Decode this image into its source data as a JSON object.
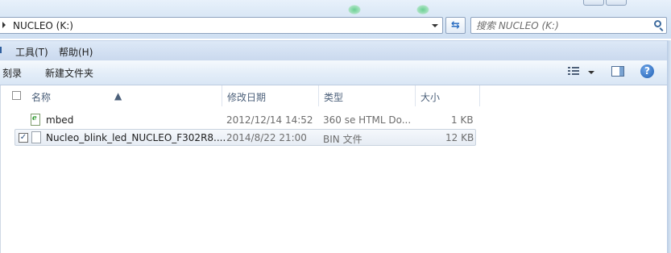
{
  "address_bar": {
    "path": "NUCLEO (K:)"
  },
  "search": {
    "placeholder": "搜索 NUCLEO (K:)"
  },
  "menu": {
    "items": [
      {
        "label": "工具(T)"
      },
      {
        "label": "帮助(H)"
      }
    ]
  },
  "toolbar": {
    "burn_label": "刻录",
    "new_folder_label": "新建文件夹",
    "help_glyph": "?"
  },
  "columns": [
    "名称",
    "修改日期",
    "类型",
    "大小"
  ],
  "files": [
    {
      "name": "mbed",
      "modified": "2012/12/14 14:52",
      "type": "360 se HTML Do...",
      "size": "1 KB",
      "icon": "html-file-icon",
      "selected": false
    },
    {
      "name": "Nucleo_blink_led_NUCLEO_F302R8....",
      "modified": "2014/8/22 21:00",
      "type": "BIN 文件",
      "size": "12 KB",
      "icon": "file-icon",
      "selected": true,
      "check": "✓"
    }
  ],
  "colors": {
    "selection_border": "#c9d3df",
    "chrome": "#dbe8f6",
    "header_text": "#4c607a"
  }
}
